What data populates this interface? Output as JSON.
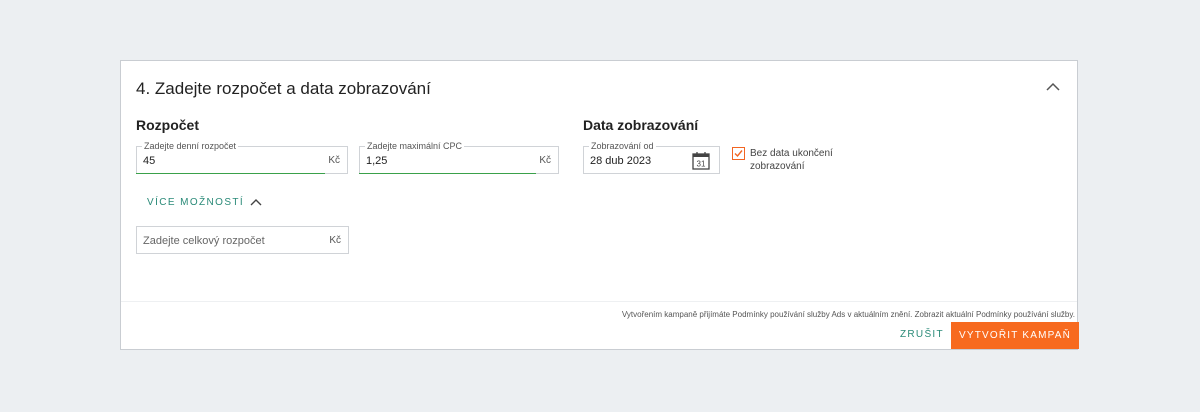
{
  "section": {
    "title": "4. Zadejte rozpočet a data zobrazování"
  },
  "budget": {
    "heading": "Rozpočet",
    "daily": {
      "label": "Zadejte denní rozpočet",
      "value": "45",
      "suffix": "Kč"
    },
    "max_cpc": {
      "label": "Zadejte maximální CPC",
      "value": "1,25",
      "suffix": "Kč"
    },
    "more_options_label": "VÍCE MOŽNOSTÍ",
    "total": {
      "placeholder": "Zadejte celkový rozpočet",
      "suffix": "Kč"
    }
  },
  "dates": {
    "heading": "Data zobrazování",
    "start": {
      "label": "Zobrazování od",
      "value": "28 dub 2023",
      "calendar_day": "31"
    },
    "no_end": {
      "label": "Bez data ukončení zobrazování",
      "checked": true
    }
  },
  "footer": {
    "terms": "Vytvořením kampaně přijímáte Podmínky používání služby Ads v aktuálním znění. Zobrazit aktuální Podmínky používání služby.",
    "cancel_label": "ZRUŠIT",
    "create_label": "VYTVOŘIT KAMPAŇ"
  },
  "colors": {
    "accent": "#f76a1f",
    "link": "#2a8a78",
    "focus_line": "#3aa14a"
  },
  "icons": {
    "collapse": "chevron-up-icon",
    "more_options": "chevron-up-icon",
    "calendar": "calendar-icon",
    "checkbox": "check-icon"
  }
}
